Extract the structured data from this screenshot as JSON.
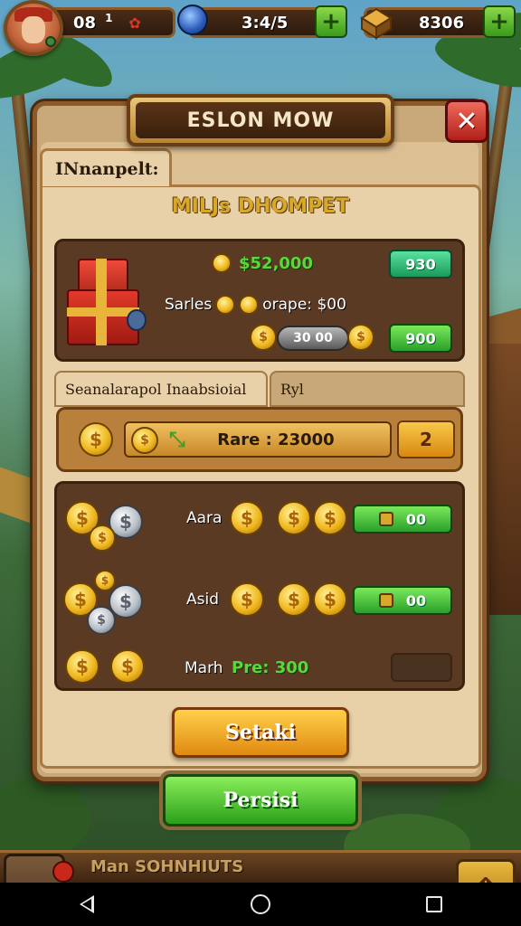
{
  "hud": {
    "level_value": "08",
    "level_sup": "1",
    "gems_value": "3:4/5",
    "gold_value": "8306"
  },
  "dialog": {
    "title": "ESLON MOW",
    "tab_label": "INnanpelt:",
    "section_title": "MILJs DHOMPET",
    "offer": {
      "amount": "$52,000",
      "sales_label": "Sarles",
      "sales_suffix": "orape: $00",
      "slider_value": "30   00",
      "btn_top_label": "930",
      "btn_bottom_label": "900"
    },
    "subtabs": [
      {
        "label": "Seanalarapol Inaabsioial"
      },
      {
        "label": "Ryl"
      }
    ],
    "rate": {
      "label": "Rare : 23000",
      "arrow_label": "2"
    },
    "rows": [
      {
        "label": "Aara",
        "btn_label": "00"
      },
      {
        "label": "Asid",
        "btn_label": "00"
      },
      {
        "label": "Marh",
        "value": "Pre: 300"
      }
    ],
    "orange_button": "Setaki",
    "green_button": "Persisi"
  },
  "bottom": {
    "label": "Man SOHNHIUTS"
  },
  "colors": {
    "accent_green": "#5ad83a",
    "title_gold": "#d8a82a",
    "close_red": "#d8281a",
    "panel_brown": "#5a3a22"
  }
}
